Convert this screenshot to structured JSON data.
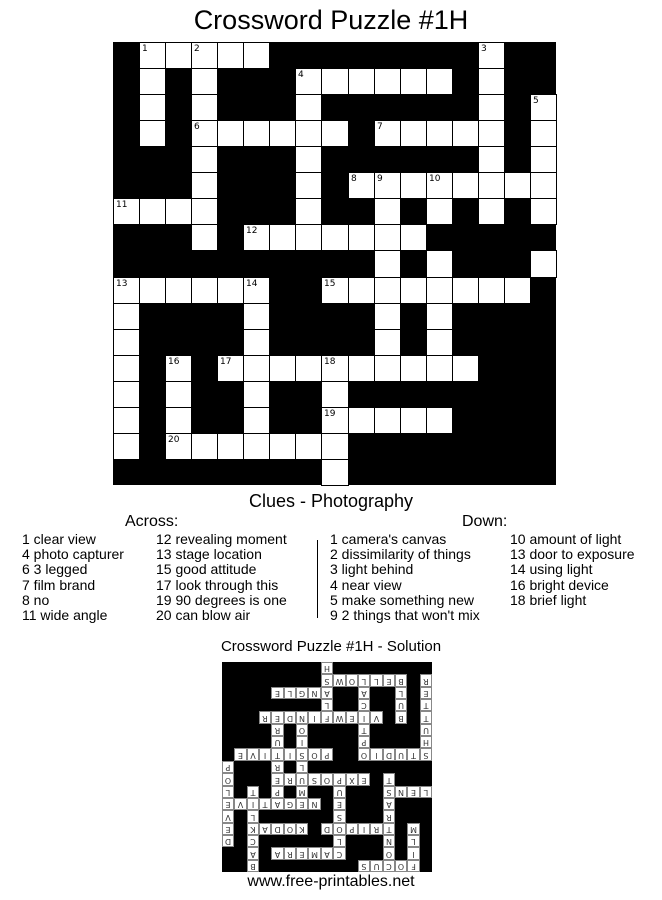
{
  "title": "Crossword Puzzle #1H",
  "grid": {
    "size": 17,
    "rows": [
      "#WWWWW########W##",
      "#W#W###WWWWWW#W##",
      "#W#W###W######W#W",
      "#W#WWWWWW#WWWWW#W",
      "###W###W######W#W",
      "###W###W#WWWWWWWW",
      "WWWW###W##W#W#W#W",
      "###W#WWWWWWW#####",
      "##########W#W###W",
      "WWWWWW##WWWWWWWW#",
      "W####W####W#W####",
      "W####W####W#W####",
      "W#W#WWWWWWWWWW###",
      "W#W##W##W########",
      "W#W##W##WWWWW####",
      "W#WWWWWWW########",
      "########W########"
    ],
    "numbers": [
      {
        "r": 0,
        "c": 1,
        "n": "1"
      },
      {
        "r": 0,
        "c": 3,
        "n": "2"
      },
      {
        "r": 0,
        "c": 14,
        "n": "3"
      },
      {
        "r": 1,
        "c": 7,
        "n": "4"
      },
      {
        "r": 2,
        "c": 16,
        "n": "5"
      },
      {
        "r": 3,
        "c": 3,
        "n": "6"
      },
      {
        "r": 3,
        "c": 10,
        "n": "7"
      },
      {
        "r": 5,
        "c": 9,
        "n": "8"
      },
      {
        "r": 5,
        "c": 10,
        "n": "9"
      },
      {
        "r": 5,
        "c": 12,
        "n": "10"
      },
      {
        "r": 6,
        "c": 0,
        "n": "11"
      },
      {
        "r": 7,
        "c": 5,
        "n": "12"
      },
      {
        "r": 9,
        "c": 0,
        "n": "13"
      },
      {
        "r": 9,
        "c": 5,
        "n": "14"
      },
      {
        "r": 9,
        "c": 8,
        "n": "15"
      },
      {
        "r": 12,
        "c": 2,
        "n": "16"
      },
      {
        "r": 12,
        "c": 4,
        "n": "17"
      },
      {
        "r": 12,
        "c": 8,
        "n": "18"
      },
      {
        "r": 14,
        "c": 8,
        "n": "19"
      },
      {
        "r": 15,
        "c": 2,
        "n": "20"
      }
    ]
  },
  "clues": {
    "title": "Clues - Photography",
    "across_heading": "Across:",
    "down_heading": "Down:",
    "across_col1": [
      "1 clear view",
      "4 photo capturer",
      "6 3 legged",
      "7 film brand",
      "8 no",
      "11 wide angle"
    ],
    "across_col2": [
      "12 revealing moment",
      "13 stage location",
      "15 good attitude",
      "17 look through this",
      "19 90 degrees is one",
      "20 can blow air"
    ],
    "down_col1": [
      "1 camera's canvas",
      "2 dissimilarity of things",
      "3 light behind",
      "4 near view",
      "5 make something new",
      "9 2 things that won't mix"
    ],
    "down_col2": [
      "10 amount of light",
      "13 door to exposure",
      "14 using light",
      "16 bright device",
      "18 brief light"
    ]
  },
  "solution": {
    "title": "Crossword Puzzle #1H - Solution",
    "rows": [
      "#FOCUS########B##",
      "#I#O###CAMERA#A##",
      "#L#N###L######C#D",
      "#M#TRIPOD#KODAK#E",
      "###R###S######L#V",
      "###A###E#NEGATIVE",
      "LENS###U##M#P#T#L",
      "###T#EXPOSURE###O",
      "##########L#R###P",
      "STUDIO##POSITIVE#",
      "H####P####I#U####",
      "U####T####O#R####",
      "T#B#VIEWFINDER###",
      "T#U##C##L########",
      "E#L##A##ANGLE####",
      "R#BELLOWS########",
      "########H########"
    ]
  },
  "footer": "www.free-printables.net"
}
